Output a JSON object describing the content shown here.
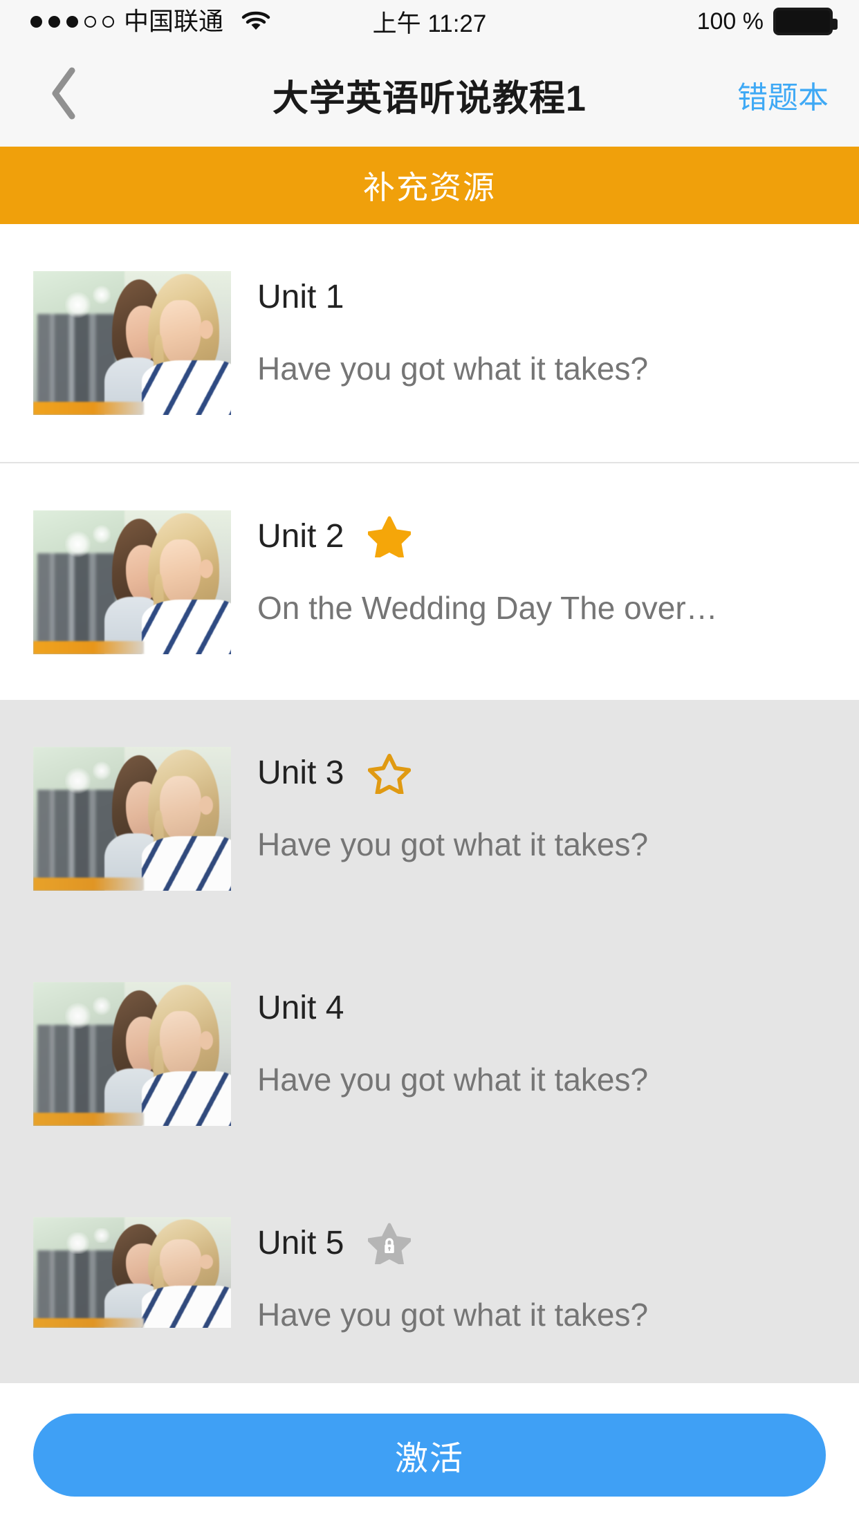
{
  "status_bar": {
    "signal_dots_filled": 3,
    "signal_dots_total": 5,
    "carrier": "中国联通",
    "wifi_icon": "wifi-icon",
    "time": "上午 11:27",
    "battery_percent": "100 %",
    "battery_level": 100
  },
  "nav_bar": {
    "back_icon": "chevron-left-icon",
    "title": "大学英语听说教程1",
    "right_action_label": "错题本",
    "right_action_color": "#3fa9f5"
  },
  "banner": {
    "label": "补充资源",
    "background_color": "#f0a00b",
    "text_color": "#ffffff"
  },
  "units": [
    {
      "title": "Unit 1",
      "subtitle": "Have you got what it takes?",
      "star": "none",
      "section": "white"
    },
    {
      "title": "Unit 2",
      "subtitle": "On the Wedding Day The over…",
      "star": "filled",
      "section": "white"
    },
    {
      "title": "Unit 3",
      "subtitle": "Have you got what it takes?",
      "star": "outline",
      "section": "gray"
    },
    {
      "title": "Unit 4",
      "subtitle": "Have you got what it takes?",
      "star": "none",
      "section": "gray"
    },
    {
      "title": "Unit 5",
      "subtitle": "Have you got what it takes?",
      "star": "locked",
      "section": "gray"
    }
  ],
  "colors": {
    "star_filled": "#f5a609",
    "star_outline": "#e09a12",
    "star_locked": "#b5b5b5",
    "section_gray": "#e5e5e5",
    "accent_blue": "#3fa0f5"
  },
  "bottom": {
    "activate_label": "激活"
  }
}
